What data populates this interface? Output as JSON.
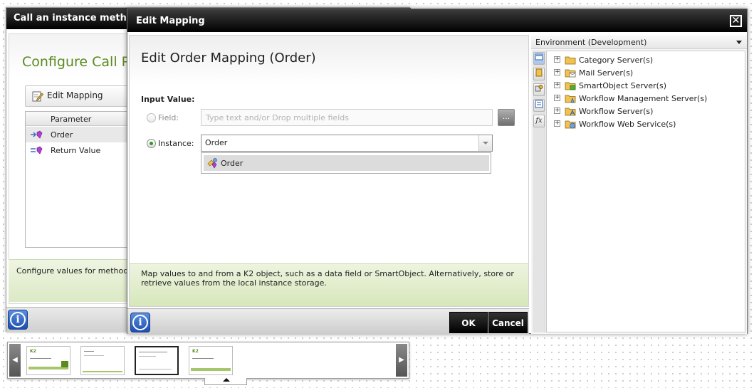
{
  "background_dialog": {
    "title": "Call an instance method",
    "heading": "Configure Call P",
    "toolbar": {
      "edit_mapping_label": "Edit Mapping",
      "edit_icon": "pencil-note-icon"
    },
    "grid": {
      "column_header": "Parameter",
      "rows": [
        {
          "label": "Order",
          "icon": "input-parameter-icon"
        },
        {
          "label": "Return Value",
          "icon": "return-value-icon"
        }
      ]
    },
    "footer_text": "Configure values for method ca",
    "info_icon": "info-icon"
  },
  "thumbnail_strip": {
    "prev_icon": "chevron-left-icon",
    "next_icon": "chevron-right-icon",
    "thumbnails": [
      {
        "logo": "K2",
        "selected": false
      },
      {
        "logo": "",
        "selected": false
      },
      {
        "logo": "",
        "selected": true
      },
      {
        "logo": "K2",
        "selected": false
      }
    ]
  },
  "dialog": {
    "title": "Edit Mapping",
    "close_icon": "close-icon",
    "heading": "Edit Order Mapping (Order)",
    "input_value_label": "Input Value:",
    "field": {
      "label": "Field:",
      "placeholder": "Type text and/or Drop multiple fields",
      "browse_label": "...",
      "enabled": false
    },
    "instance": {
      "label": "Instance:",
      "selected_value": "Order",
      "checked": true,
      "options": [
        {
          "label": "Order",
          "icon": "instance-object-icon"
        }
      ]
    },
    "help_text": "Map values to and from a K2 object, such as a data field or SmartObject. Alternatively, store or retrieve values from the local instance storage.",
    "buttons": {
      "ok": "OK",
      "cancel": "Cancel"
    },
    "info_icon": "info-icon"
  },
  "environment_panel": {
    "title": "Environment (Development)",
    "side_tabs": [
      {
        "icon": "context-browser-icon",
        "label": ""
      },
      {
        "icon": "object-browser-icon",
        "label": ""
      },
      {
        "icon": "process-browser-icon",
        "label": ""
      },
      {
        "icon": "field-browser-icon",
        "label": ""
      },
      {
        "icon": "function-browser-icon",
        "label": "fx"
      }
    ],
    "tree": [
      {
        "label": "Category Server(s)",
        "icon": "folder-icon",
        "expander": "+"
      },
      {
        "label": "Mail Server(s)",
        "icon": "mail-folder-icon",
        "expander": "+"
      },
      {
        "label": "SmartObject Server(s)",
        "icon": "smartobject-folder-icon",
        "expander": "+"
      },
      {
        "label": "Workflow Management Server(s)",
        "icon": "workflow-management-folder-icon",
        "expander": "+"
      },
      {
        "label": "Workflow Server(s)",
        "icon": "workflow-folder-icon",
        "expander": "+"
      },
      {
        "label": "Workflow Web Service(s)",
        "icon": "web-service-folder-icon",
        "expander": "+"
      }
    ]
  },
  "colors": {
    "title_bar": "#000000",
    "heading_green": "#5b8a1f",
    "help_panel": "#dce9c5",
    "radio_checked": "#2f9a21",
    "info_blue": "#1c4fb0"
  }
}
